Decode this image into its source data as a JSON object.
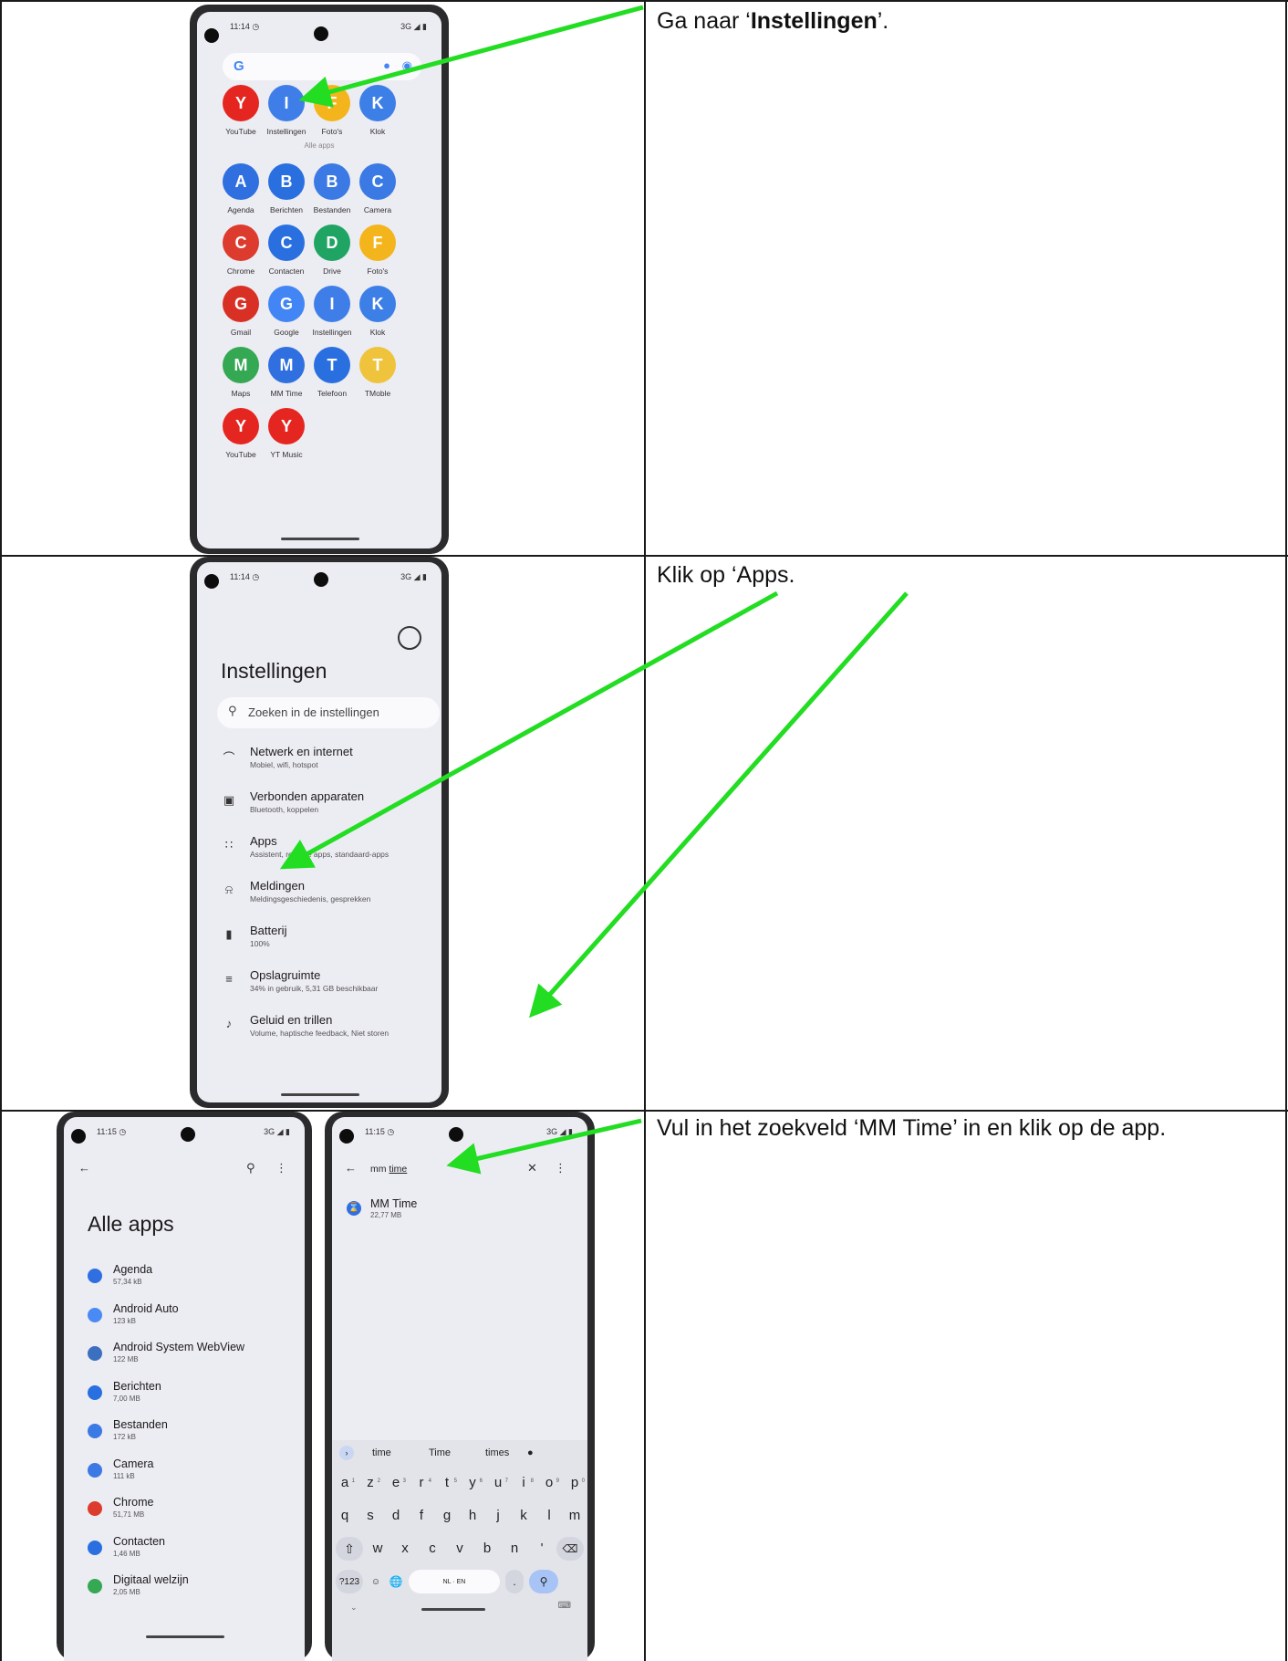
{
  "rows": [
    {
      "instruction_prefix": "Ga naar ‘",
      "instruction_bold": "Instellingen",
      "instruction_suffix": "’.",
      "phone": {
        "time": "11:14 ◷",
        "signal": "3G ◢ ▮",
        "apps_top": [
          {
            "label": "YouTube",
            "icon": "youtube-icon",
            "color": "#e52620"
          },
          {
            "label": "Instellingen",
            "icon": "settings-gear-icon",
            "color": "#3f7ee8"
          },
          {
            "label": "Foto's",
            "icon": "photos-icon",
            "color": "#f3b51b"
          },
          {
            "label": "Klok",
            "icon": "clock-icon",
            "color": "#3c7fe6"
          }
        ],
        "all_apps_caption": "Alle apps",
        "apps": [
          {
            "label": "Agenda",
            "icon": "calendar-icon",
            "color": "#2f6fe0"
          },
          {
            "label": "Berichten",
            "icon": "messages-icon",
            "color": "#2a6fe0"
          },
          {
            "label": "Bestanden",
            "icon": "files-icon",
            "color": "#3b79e4"
          },
          {
            "label": "Camera",
            "icon": "camera-icon",
            "color": "#3b79e4"
          },
          {
            "label": "Chrome",
            "icon": "chrome-icon",
            "color": "#dc3b2d"
          },
          {
            "label": "Contacten",
            "icon": "contacts-icon",
            "color": "#2a6fe0"
          },
          {
            "label": "Drive",
            "icon": "drive-icon",
            "color": "#1fa463"
          },
          {
            "label": "Foto's",
            "icon": "photos-icon",
            "color": "#f3b51b"
          },
          {
            "label": "Gmail",
            "icon": "gmail-icon",
            "color": "#d93025"
          },
          {
            "label": "Google",
            "icon": "google-icon",
            "color": "#4285f4"
          },
          {
            "label": "Instellingen",
            "icon": "settings-gear-icon",
            "color": "#3f7ee8"
          },
          {
            "label": "Klok",
            "icon": "clock-icon",
            "color": "#3c7fe6"
          },
          {
            "label": "Maps",
            "icon": "maps-icon",
            "color": "#34a853"
          },
          {
            "label": "MM Time",
            "icon": "hourglass-icon",
            "color": "#2f6fe0"
          },
          {
            "label": "Telefoon",
            "icon": "phone-icon",
            "color": "#2a6fe0"
          },
          {
            "label": "TMoble",
            "icon": "tmoble-icon",
            "color": "#f0c33c"
          },
          {
            "label": "YouTube",
            "icon": "youtube-icon",
            "color": "#e52620"
          },
          {
            "label": "YT Music",
            "icon": "yt-music-icon",
            "color": "#e52620"
          }
        ]
      }
    },
    {
      "instruction": "Klik op ‘Apps.",
      "phone": {
        "time": "11:14 ◷",
        "signal": "3G ◢ ▮",
        "title": "Instellingen",
        "search_placeholder": "Zoeken in de instellingen",
        "items": [
          {
            "title": "Netwerk en internet",
            "subtitle": "Mobiel, wifi, hotspot",
            "icon": "wifi-icon",
            "glyph": "⌒"
          },
          {
            "title": "Verbonden apparaten",
            "subtitle": "Bluetooth, koppelen",
            "icon": "devices-icon",
            "glyph": "▣"
          },
          {
            "title": "Apps",
            "subtitle": "Assistent, recente apps, standaard-apps",
            "icon": "apps-grid-icon",
            "glyph": "∷"
          },
          {
            "title": "Meldingen",
            "subtitle": "Meldingsgeschiedenis, gesprekken",
            "icon": "bell-icon",
            "glyph": "⍾"
          },
          {
            "title": "Batterij",
            "subtitle": "100%",
            "icon": "battery-icon",
            "glyph": "▮"
          },
          {
            "title": "Opslagruimte",
            "subtitle": "34% in gebruik, 5,31 GB beschikbaar",
            "icon": "storage-icon",
            "glyph": "≡"
          },
          {
            "title": "Geluid en trillen",
            "subtitle": "Volume, haptische feedback, Niet storen",
            "icon": "sound-icon",
            "glyph": "♪"
          }
        ]
      }
    },
    {
      "instruction": "Vul in het zoekveld ‘MM Time’ in en klik op de app.",
      "phone_left": {
        "time": "11:15 ◷",
        "signal": "3G ◢ ▮",
        "title": "Alle apps",
        "items": [
          {
            "title": "Agenda",
            "size": "57,34 kB",
            "color": "#2f6fe0"
          },
          {
            "title": "Android Auto",
            "size": "123 kB",
            "color": "#4a8af4"
          },
          {
            "title": "Android System WebView",
            "size": "122 MB",
            "color": "#3b6fc0"
          },
          {
            "title": "Berichten",
            "size": "7,00 MB",
            "color": "#2a6fe0"
          },
          {
            "title": "Bestanden",
            "size": "172 kB",
            "color": "#3b79e4"
          },
          {
            "title": "Camera",
            "size": "111 kB",
            "color": "#3b79e4"
          },
          {
            "title": "Chrome",
            "size": "51,71 MB",
            "color": "#dc3b2d"
          },
          {
            "title": "Contacten",
            "size": "1,46 MB",
            "color": "#2a6fe0"
          },
          {
            "title": "Digitaal welzijn",
            "size": "2,05 MB",
            "color": "#34a853"
          }
        ]
      },
      "phone_right": {
        "time": "11:15 ◷",
        "signal": "3G ◢ ▮",
        "query_prefix": "mm ",
        "query_underlined": "time",
        "result_title": "MM Time",
        "result_size": "22,77 MB",
        "suggestions": [
          "time",
          "Time",
          "times"
        ],
        "keys_row1": [
          [
            "a",
            "1"
          ],
          [
            "z",
            "2"
          ],
          [
            "e",
            "3"
          ],
          [
            "r",
            "4"
          ],
          [
            "t",
            "5"
          ],
          [
            "y",
            "6"
          ],
          [
            "u",
            "7"
          ],
          [
            "i",
            "8"
          ],
          [
            "o",
            "9"
          ],
          [
            "p",
            "0"
          ]
        ],
        "keys_row2": [
          "q",
          "s",
          "d",
          "f",
          "g",
          "h",
          "j",
          "k",
          "l",
          "m"
        ],
        "keys_row3": [
          "w",
          "x",
          "c",
          "v",
          "b",
          "n",
          "'"
        ],
        "key_numbers": "?123",
        "key_space": "NL · EN",
        "key_period": "."
      }
    }
  ]
}
